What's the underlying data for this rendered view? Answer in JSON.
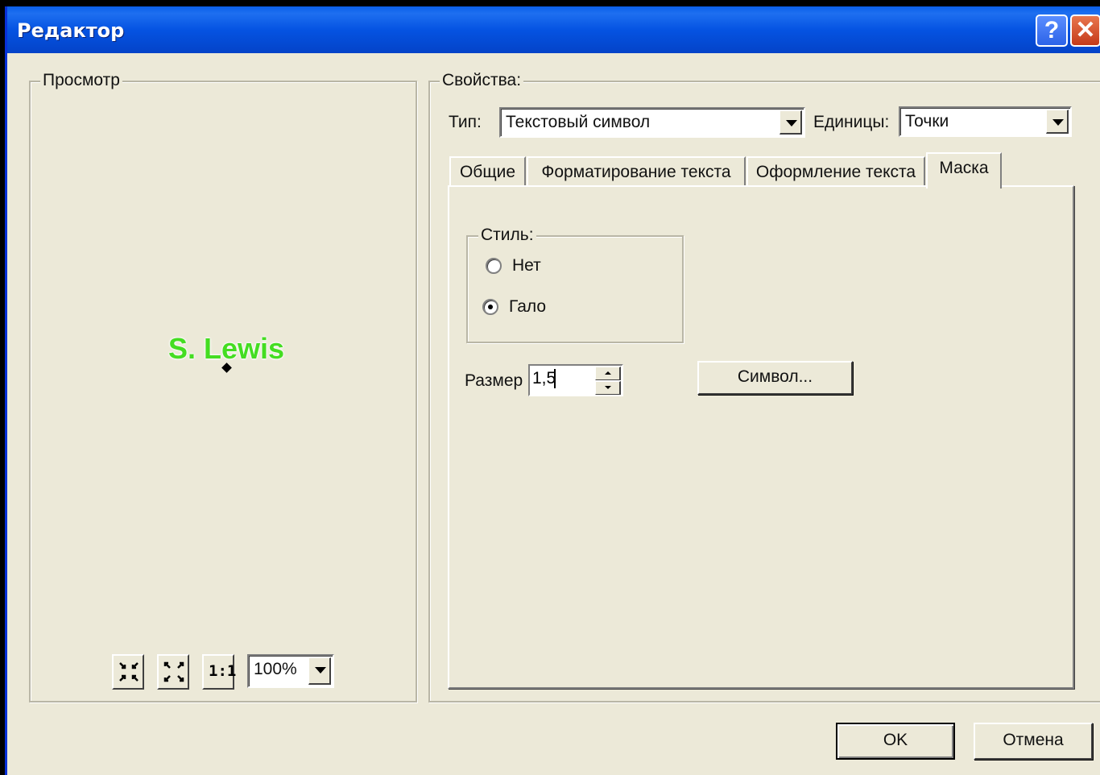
{
  "window": {
    "title": "Редактор",
    "help_glyph": "?",
    "close_glyph": "✕"
  },
  "preview": {
    "group_label": "Просмотр",
    "sample_text": "S. Lewis",
    "sample_color": "#44DD22",
    "zoom_value": "100%",
    "tools": [
      "zoom-in-icon",
      "fit-extent-icon",
      "actual-size-icon"
    ],
    "actual_size_label": "1:1"
  },
  "properties": {
    "group_label": "Свойства:",
    "type_label": "Тип:",
    "type_value": "Текстовый символ",
    "units_label": "Единицы:",
    "units_value": "Точки",
    "tabs": [
      {
        "label": "Общие",
        "active": false
      },
      {
        "label": "Форматирование текста",
        "active": false
      },
      {
        "label": "Оформление текста",
        "active": false
      },
      {
        "label": "Маска",
        "active": true
      }
    ],
    "mask": {
      "style_label": "Стиль:",
      "options": [
        {
          "label": "Нет",
          "selected": false
        },
        {
          "label": "Гало",
          "selected": true
        }
      ],
      "size_label": "Размер",
      "size_value": "1,5",
      "symbol_button": "Символ..."
    }
  },
  "footer": {
    "ok_label": "OK",
    "cancel_label": "Отмена"
  }
}
